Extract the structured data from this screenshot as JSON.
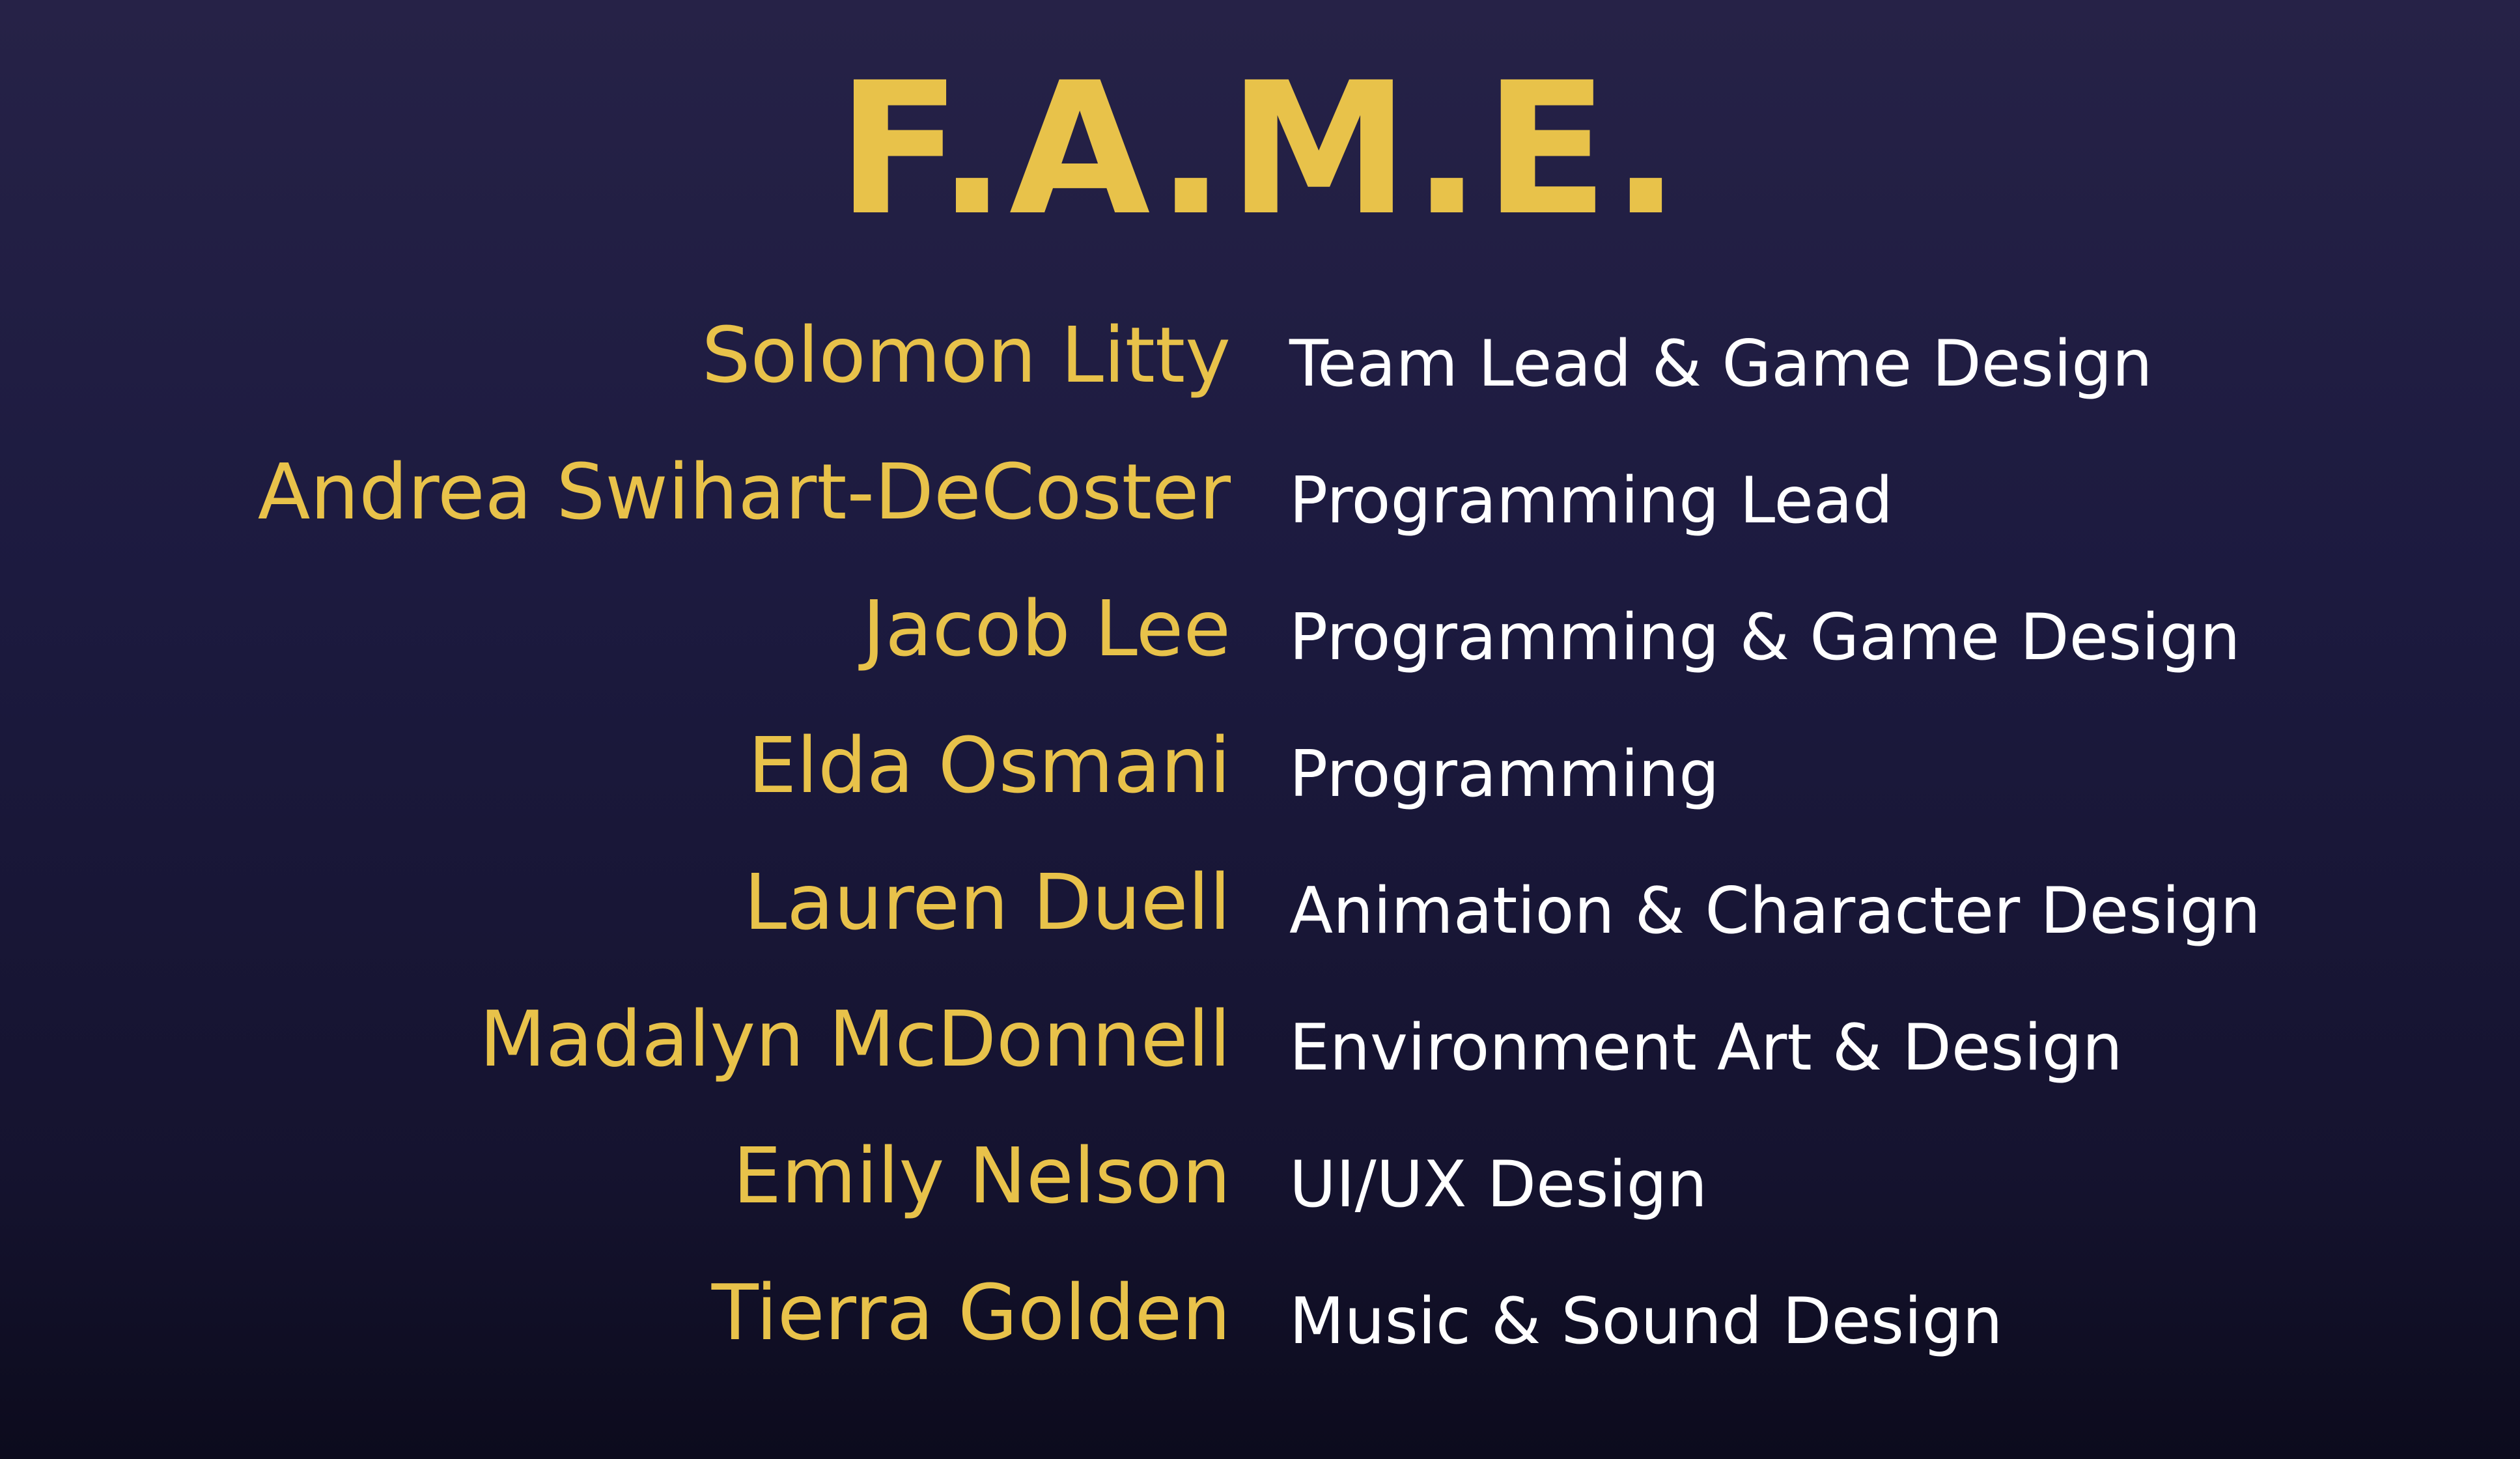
{
  "title": "F.A.M.E.",
  "credits": [
    {
      "name": "Solomon Litty",
      "role": "Team Lead & Game Design"
    },
    {
      "name": "Andrea Swihart-DeCoster",
      "role": "Programming Lead"
    },
    {
      "name": "Jacob Lee",
      "role": "Programming & Game Design"
    },
    {
      "name": "Elda Osmani",
      "role": "Programming"
    },
    {
      "name": "Lauren Duell",
      "role": "Animation & Character Design"
    },
    {
      "name": "Madalyn McDonnell",
      "role": "Environment Art & Design"
    },
    {
      "name": "Emily Nelson",
      "role": "UI/UX Design"
    },
    {
      "name": "Tierra Golden",
      "role": "Music & Sound Design"
    }
  ],
  "colors": {
    "name": "#e8c24a",
    "role": "#ffffff",
    "background": "#1c1a3f"
  }
}
